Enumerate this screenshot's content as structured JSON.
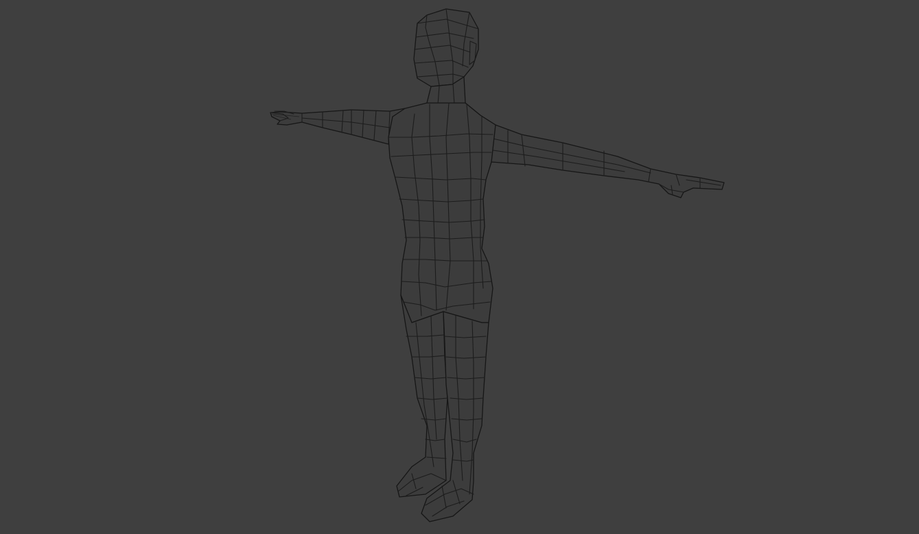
{
  "viewport": {
    "background_color": "#3f3f3f",
    "wire_color": "#1c1c1c",
    "display_mode": "wireframe",
    "object": "t-pose-character-mesh"
  }
}
